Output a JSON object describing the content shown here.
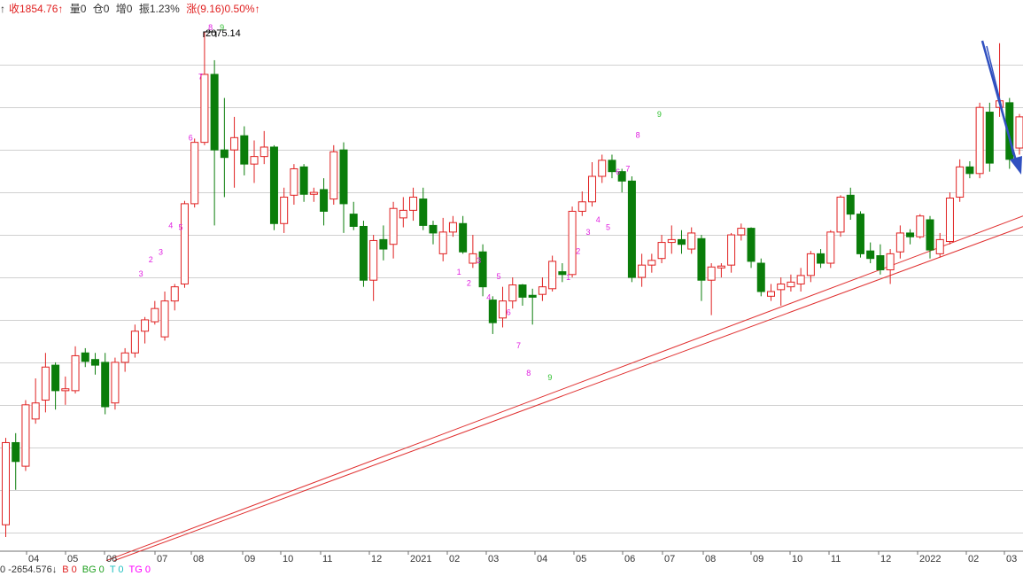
{
  "header": {
    "close_prefix": "↑",
    "close": "收1854.76↑",
    "volume": "量0",
    "position": "仓0",
    "increase": "增0",
    "amplitude": "振1.23%",
    "change": "涨(9.16)0.50%↑"
  },
  "footer": {
    "value": "0 -2654.576↓",
    "b": "B 0",
    "bg": "BG 0",
    "t": "T 0",
    "tg": "TG 0"
  },
  "colors": {
    "up": "#e02020",
    "down": "#0a7d0a",
    "grid": "#d0d0d0",
    "trendline": "#e03030",
    "arrow": "#3050c0",
    "count_marker": "#e020e0",
    "count_nine": "#30c030"
  },
  "chart_data": {
    "type": "candlestick",
    "ylim": [
      1525,
      2090
    ],
    "grid_lines_y": [
      2040,
      1995,
      1950,
      1905,
      1860,
      1815,
      1770,
      1725,
      1680,
      1635,
      1590,
      1545
    ],
    "x_ticks": [
      "04",
      "05",
      "06",
      "07",
      "08",
      "09",
      "10",
      "11",
      "12",
      "2021",
      "02",
      "03",
      "04",
      "05",
      "06",
      "07",
      "08",
      "09",
      "10",
      "11",
      "12",
      "2022",
      "02",
      "03"
    ],
    "peak_annotation": "2075.14",
    "candles": [
      {
        "o": 1553,
        "c": 1640,
        "h": 1645,
        "l": 1540,
        "dir": "up"
      },
      {
        "o": 1640,
        "c": 1620,
        "h": 1650,
        "l": 1590,
        "dir": "down"
      },
      {
        "o": 1615,
        "c": 1680,
        "h": 1685,
        "l": 1610,
        "dir": "up"
      },
      {
        "o": 1665,
        "c": 1682,
        "h": 1708,
        "l": 1660,
        "dir": "up"
      },
      {
        "o": 1685,
        "c": 1720,
        "h": 1735,
        "l": 1672,
        "dir": "up"
      },
      {
        "o": 1722,
        "c": 1695,
        "h": 1725,
        "l": 1675,
        "dir": "down"
      },
      {
        "o": 1695,
        "c": 1697,
        "h": 1710,
        "l": 1680,
        "dir": "up"
      },
      {
        "o": 1695,
        "c": 1732,
        "h": 1742,
        "l": 1692,
        "dir": "up"
      },
      {
        "o": 1735,
        "c": 1726,
        "h": 1740,
        "l": 1720,
        "dir": "down"
      },
      {
        "o": 1728,
        "c": 1722,
        "h": 1735,
        "l": 1712,
        "dir": "down"
      },
      {
        "o": 1725,
        "c": 1678,
        "h": 1735,
        "l": 1670,
        "dir": "down"
      },
      {
        "o": 1682,
        "c": 1725,
        "h": 1730,
        "l": 1675,
        "dir": "up"
      },
      {
        "o": 1725,
        "c": 1735,
        "h": 1740,
        "l": 1715,
        "dir": "up"
      },
      {
        "o": 1735,
        "c": 1758,
        "h": 1765,
        "l": 1730,
        "dir": "up"
      },
      {
        "o": 1758,
        "c": 1770,
        "h": 1773,
        "l": 1745,
        "dir": "up"
      },
      {
        "o": 1768,
        "c": 1782,
        "h": 1790,
        "l": 1765,
        "dir": "up"
      },
      {
        "o": 1752,
        "c": 1790,
        "h": 1800,
        "l": 1748,
        "dir": "up"
      },
      {
        "o": 1790,
        "c": 1805,
        "h": 1808,
        "l": 1780,
        "dir": "up"
      },
      {
        "o": 1808,
        "c": 1893,
        "h": 1896,
        "l": 1804,
        "dir": "up"
      },
      {
        "o": 1893,
        "c": 1958,
        "h": 1962,
        "l": 1889,
        "dir": "up"
      },
      {
        "o": 1958,
        "c": 2030,
        "h": 2075,
        "l": 1955,
        "dir": "up"
      },
      {
        "o": 2030,
        "c": 1950,
        "h": 2045,
        "l": 1870,
        "dir": "down"
      },
      {
        "o": 1950,
        "c": 1942,
        "h": 2005,
        "l": 1900,
        "dir": "down"
      },
      {
        "o": 1950,
        "c": 1963,
        "h": 1985,
        "l": 1910,
        "dir": "up"
      },
      {
        "o": 1965,
        "c": 1935,
        "h": 1975,
        "l": 1923,
        "dir": "down"
      },
      {
        "o": 1935,
        "c": 1943,
        "h": 1960,
        "l": 1915,
        "dir": "up"
      },
      {
        "o": 1943,
        "c": 1953,
        "h": 1970,
        "l": 1935,
        "dir": "up"
      },
      {
        "o": 1953,
        "c": 1872,
        "h": 1955,
        "l": 1865,
        "dir": "down"
      },
      {
        "o": 1872,
        "c": 1900,
        "h": 1910,
        "l": 1862,
        "dir": "up"
      },
      {
        "o": 1902,
        "c": 1930,
        "h": 1935,
        "l": 1892,
        "dir": "up"
      },
      {
        "o": 1932,
        "c": 1903,
        "h": 1935,
        "l": 1895,
        "dir": "down"
      },
      {
        "o": 1903,
        "c": 1905,
        "h": 1910,
        "l": 1895,
        "dir": "up"
      },
      {
        "o": 1908,
        "c": 1885,
        "h": 1920,
        "l": 1870,
        "dir": "down"
      },
      {
        "o": 1898,
        "c": 1948,
        "h": 1955,
        "l": 1892,
        "dir": "up"
      },
      {
        "o": 1950,
        "c": 1893,
        "h": 1958,
        "l": 1862,
        "dir": "down"
      },
      {
        "o": 1882,
        "c": 1869,
        "h": 1895,
        "l": 1865,
        "dir": "down"
      },
      {
        "o": 1869,
        "c": 1812,
        "h": 1875,
        "l": 1805,
        "dir": "down"
      },
      {
        "o": 1812,
        "c": 1854,
        "h": 1860,
        "l": 1790,
        "dir": "up"
      },
      {
        "o": 1855,
        "c": 1845,
        "h": 1870,
        "l": 1833,
        "dir": "down"
      },
      {
        "o": 1850,
        "c": 1888,
        "h": 1895,
        "l": 1835,
        "dir": "up"
      },
      {
        "o": 1878,
        "c": 1886,
        "h": 1900,
        "l": 1868,
        "dir": "up"
      },
      {
        "o": 1886,
        "c": 1900,
        "h": 1910,
        "l": 1875,
        "dir": "up"
      },
      {
        "o": 1898,
        "c": 1870,
        "h": 1910,
        "l": 1865,
        "dir": "down"
      },
      {
        "o": 1870,
        "c": 1862,
        "h": 1875,
        "l": 1850,
        "dir": "down"
      },
      {
        "o": 1840,
        "c": 1863,
        "h": 1878,
        "l": 1832,
        "dir": "up"
      },
      {
        "o": 1863,
        "c": 1873,
        "h": 1880,
        "l": 1858,
        "dir": "up"
      },
      {
        "o": 1872,
        "c": 1842,
        "h": 1880,
        "l": 1840,
        "dir": "down"
      },
      {
        "o": 1830,
        "c": 1840,
        "h": 1860,
        "l": 1825,
        "dir": "up"
      },
      {
        "o": 1842,
        "c": 1805,
        "h": 1850,
        "l": 1795,
        "dir": "down"
      },
      {
        "o": 1791,
        "c": 1767,
        "h": 1795,
        "l": 1755,
        "dir": "down"
      },
      {
        "o": 1772,
        "c": 1790,
        "h": 1805,
        "l": 1762,
        "dir": "up"
      },
      {
        "o": 1790,
        "c": 1807,
        "h": 1815,
        "l": 1782,
        "dir": "up"
      },
      {
        "o": 1807,
        "c": 1794,
        "h": 1808,
        "l": 1785,
        "dir": "down"
      },
      {
        "o": 1794,
        "c": 1796,
        "h": 1803,
        "l": 1765,
        "dir": "down"
      },
      {
        "o": 1797,
        "c": 1805,
        "h": 1815,
        "l": 1790,
        "dir": "up"
      },
      {
        "o": 1803,
        "c": 1832,
        "h": 1838,
        "l": 1800,
        "dir": "up"
      },
      {
        "o": 1821,
        "c": 1818,
        "h": 1830,
        "l": 1810,
        "dir": "down"
      },
      {
        "o": 1818,
        "c": 1885,
        "h": 1890,
        "l": 1815,
        "dir": "up"
      },
      {
        "o": 1885,
        "c": 1895,
        "h": 1906,
        "l": 1880,
        "dir": "up"
      },
      {
        "o": 1895,
        "c": 1922,
        "h": 1937,
        "l": 1890,
        "dir": "up"
      },
      {
        "o": 1922,
        "c": 1939,
        "h": 1945,
        "l": 1915,
        "dir": "up"
      },
      {
        "o": 1939,
        "c": 1927,
        "h": 1945,
        "l": 1920,
        "dir": "down"
      },
      {
        "o": 1927,
        "c": 1917,
        "h": 1930,
        "l": 1905,
        "dir": "down"
      },
      {
        "o": 1917,
        "c": 1815,
        "h": 1922,
        "l": 1810,
        "dir": "down"
      },
      {
        "o": 1815,
        "c": 1828,
        "h": 1840,
        "l": 1805,
        "dir": "up"
      },
      {
        "o": 1828,
        "c": 1833,
        "h": 1840,
        "l": 1820,
        "dir": "up"
      },
      {
        "o": 1835,
        "c": 1852,
        "h": 1860,
        "l": 1830,
        "dir": "up"
      },
      {
        "o": 1852,
        "c": 1855,
        "h": 1870,
        "l": 1840,
        "dir": "up"
      },
      {
        "o": 1855,
        "c": 1850,
        "h": 1865,
        "l": 1840,
        "dir": "down"
      },
      {
        "o": 1845,
        "c": 1862,
        "h": 1868,
        "l": 1840,
        "dir": "up"
      },
      {
        "o": 1856,
        "c": 1812,
        "h": 1860,
        "l": 1790,
        "dir": "down"
      },
      {
        "o": 1812,
        "c": 1826,
        "h": 1830,
        "l": 1775,
        "dir": "up"
      },
      {
        "o": 1825,
        "c": 1827,
        "h": 1830,
        "l": 1815,
        "dir": "up"
      },
      {
        "o": 1828,
        "c": 1860,
        "h": 1862,
        "l": 1820,
        "dir": "up"
      },
      {
        "o": 1860,
        "c": 1867,
        "h": 1872,
        "l": 1854,
        "dir": "up"
      },
      {
        "o": 1867,
        "c": 1832,
        "h": 1868,
        "l": 1825,
        "dir": "down"
      },
      {
        "o": 1830,
        "c": 1800,
        "h": 1835,
        "l": 1795,
        "dir": "down"
      },
      {
        "o": 1795,
        "c": 1800,
        "h": 1808,
        "l": 1790,
        "dir": "up"
      },
      {
        "o": 1802,
        "c": 1808,
        "h": 1815,
        "l": 1785,
        "dir": "up"
      },
      {
        "o": 1805,
        "c": 1810,
        "h": 1818,
        "l": 1800,
        "dir": "up"
      },
      {
        "o": 1808,
        "c": 1817,
        "h": 1825,
        "l": 1800,
        "dir": "up"
      },
      {
        "o": 1817,
        "c": 1840,
        "h": 1843,
        "l": 1810,
        "dir": "up"
      },
      {
        "o": 1840,
        "c": 1830,
        "h": 1845,
        "l": 1825,
        "dir": "down"
      },
      {
        "o": 1830,
        "c": 1863,
        "h": 1865,
        "l": 1825,
        "dir": "up"
      },
      {
        "o": 1863,
        "c": 1900,
        "h": 1902,
        "l": 1858,
        "dir": "up"
      },
      {
        "o": 1902,
        "c": 1882,
        "h": 1910,
        "l": 1876,
        "dir": "down"
      },
      {
        "o": 1882,
        "c": 1840,
        "h": 1885,
        "l": 1836,
        "dir": "down"
      },
      {
        "o": 1843,
        "c": 1835,
        "h": 1852,
        "l": 1830,
        "dir": "down"
      },
      {
        "o": 1838,
        "c": 1823,
        "h": 1850,
        "l": 1818,
        "dir": "down"
      },
      {
        "o": 1823,
        "c": 1840,
        "h": 1845,
        "l": 1808,
        "dir": "up"
      },
      {
        "o": 1842,
        "c": 1862,
        "h": 1870,
        "l": 1835,
        "dir": "up"
      },
      {
        "o": 1862,
        "c": 1858,
        "h": 1866,
        "l": 1850,
        "dir": "down"
      },
      {
        "o": 1858,
        "c": 1880,
        "h": 1882,
        "l": 1856,
        "dir": "up"
      },
      {
        "o": 1876,
        "c": 1844,
        "h": 1880,
        "l": 1835,
        "dir": "down"
      },
      {
        "o": 1840,
        "c": 1855,
        "h": 1862,
        "l": 1836,
        "dir": "up"
      },
      {
        "o": 1853,
        "c": 1899,
        "h": 1905,
        "l": 1850,
        "dir": "up"
      },
      {
        "o": 1900,
        "c": 1932,
        "h": 1940,
        "l": 1895,
        "dir": "up"
      },
      {
        "o": 1932,
        "c": 1925,
        "h": 1938,
        "l": 1920,
        "dir": "down"
      },
      {
        "o": 1925,
        "c": 1995,
        "h": 2000,
        "l": 1920,
        "dir": "up"
      },
      {
        "o": 1990,
        "c": 1936,
        "h": 2000,
        "l": 1927,
        "dir": "down"
      },
      {
        "o": 1995,
        "c": 2002,
        "h": 2063,
        "l": 1985,
        "dir": "up"
      },
      {
        "o": 2000,
        "c": 1940,
        "h": 2005,
        "l": 1930,
        "dir": "down"
      },
      {
        "o": 1952,
        "c": 1985,
        "h": 1988,
        "l": 1945,
        "dir": "up"
      }
    ],
    "trendline": {
      "from": [
        120,
        1515
      ],
      "to": [
        1155,
        1880
      ]
    },
    "counts": [
      {
        "text": "3",
        "candle": 14,
        "y": 1816,
        "color": "pink"
      },
      {
        "text": "2",
        "candle": 15,
        "y": 1831,
        "color": "pink"
      },
      {
        "text": "3",
        "candle": 16,
        "y": 1839,
        "color": "pink"
      },
      {
        "text": "4",
        "candle": 17,
        "y": 1867,
        "color": "pink"
      },
      {
        "text": "5",
        "candle": 18,
        "y": 1865,
        "color": "pink"
      },
      {
        "text": "6",
        "candle": 19,
        "y": 1960,
        "color": "pink"
      },
      {
        "text": "7",
        "candle": 20,
        "y": 2025,
        "color": "pink"
      },
      {
        "text": "8",
        "candle": 21,
        "y": 2077,
        "color": "pink"
      },
      {
        "text": "9",
        "candle": 21,
        "y": 2077,
        "color": "nine"
      },
      {
        "text": "1",
        "candle": 46,
        "y": 1818,
        "color": "pink"
      },
      {
        "text": "2",
        "candle": 47,
        "y": 1806,
        "color": "pink"
      },
      {
        "text": "3",
        "candle": 48,
        "y": 1830,
        "color": "pink"
      },
      {
        "text": "4",
        "candle": 49,
        "y": 1791,
        "color": "pink"
      },
      {
        "text": "5",
        "candle": 50,
        "y": 1813,
        "color": "pink"
      },
      {
        "text": "6",
        "candle": 51,
        "y": 1775,
        "color": "pink"
      },
      {
        "text": "7",
        "candle": 52,
        "y": 1740,
        "color": "pink"
      },
      {
        "text": "8",
        "candle": 53,
        "y": 1711,
        "color": "pink"
      },
      {
        "text": "9",
        "candle": 54,
        "y": 1706,
        "color": "nine"
      },
      {
        "text": "1",
        "candle": 57,
        "y": 1812,
        "color": "pink"
      },
      {
        "text": "2",
        "candle": 58,
        "y": 1840,
        "color": "pink"
      },
      {
        "text": "3",
        "candle": 59,
        "y": 1860,
        "color": "pink"
      },
      {
        "text": "4",
        "candle": 60,
        "y": 1873,
        "color": "pink"
      },
      {
        "text": "5",
        "candle": 61,
        "y": 1865,
        "color": "pink"
      },
      {
        "text": "6",
        "candle": 62,
        "y": 1924,
        "color": "pink"
      },
      {
        "text": "7",
        "candle": 63,
        "y": 1927,
        "color": "pink"
      },
      {
        "text": "8",
        "candle": 64,
        "y": 1963,
        "color": "pink"
      },
      {
        "text": "9",
        "candle": 65,
        "y": 1985,
        "color": "nine"
      }
    ]
  }
}
